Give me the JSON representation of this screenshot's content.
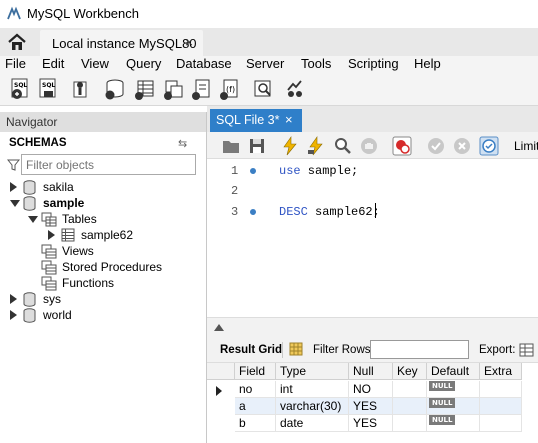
{
  "window": {
    "title": "MySQL Workbench"
  },
  "tabs": {
    "connection_tab": "Local instance MySQL80",
    "close_glyph": "×"
  },
  "menu": [
    "File",
    "Edit",
    "View",
    "Query",
    "Database",
    "Server",
    "Tools",
    "Scripting",
    "Help"
  ],
  "navigator": {
    "header": "Navigator",
    "schemas_label": "SCHEMAS",
    "filter_placeholder": "Filter objects",
    "tree": [
      {
        "label": "sakila"
      },
      {
        "label": "sample"
      },
      {
        "label": "Tables"
      },
      {
        "label": "sample62"
      },
      {
        "label": "Views"
      },
      {
        "label": "Stored Procedures"
      },
      {
        "label": "Functions"
      },
      {
        "label": "sys"
      },
      {
        "label": "world"
      }
    ]
  },
  "editor": {
    "tab_label": "SQL File 3*",
    "tab_close": "×",
    "limit_label": "Limit",
    "lines": [
      {
        "num": "1",
        "keyword": "use",
        "rest": " sample;"
      },
      {
        "num": "2",
        "keyword": "",
        "rest": ""
      },
      {
        "num": "3",
        "keyword": "DESC",
        "rest": " sample62;"
      }
    ]
  },
  "results": {
    "result_grid_label": "Result Grid",
    "filter_rows_label": "Filter Rows:",
    "export_label": "Export:",
    "columns": [
      "Field",
      "Type",
      "Null",
      "Key",
      "Default",
      "Extra"
    ],
    "rows": [
      [
        "no",
        "int",
        "NO",
        "",
        "NULL",
        ""
      ],
      [
        "a",
        "varchar(30)",
        "YES",
        "",
        "NULL",
        ""
      ],
      [
        "b",
        "date",
        "YES",
        "",
        "NULL",
        ""
      ]
    ]
  },
  "colors": {
    "accent": "#2f7fc9",
    "keyword": "#2f54c4"
  }
}
